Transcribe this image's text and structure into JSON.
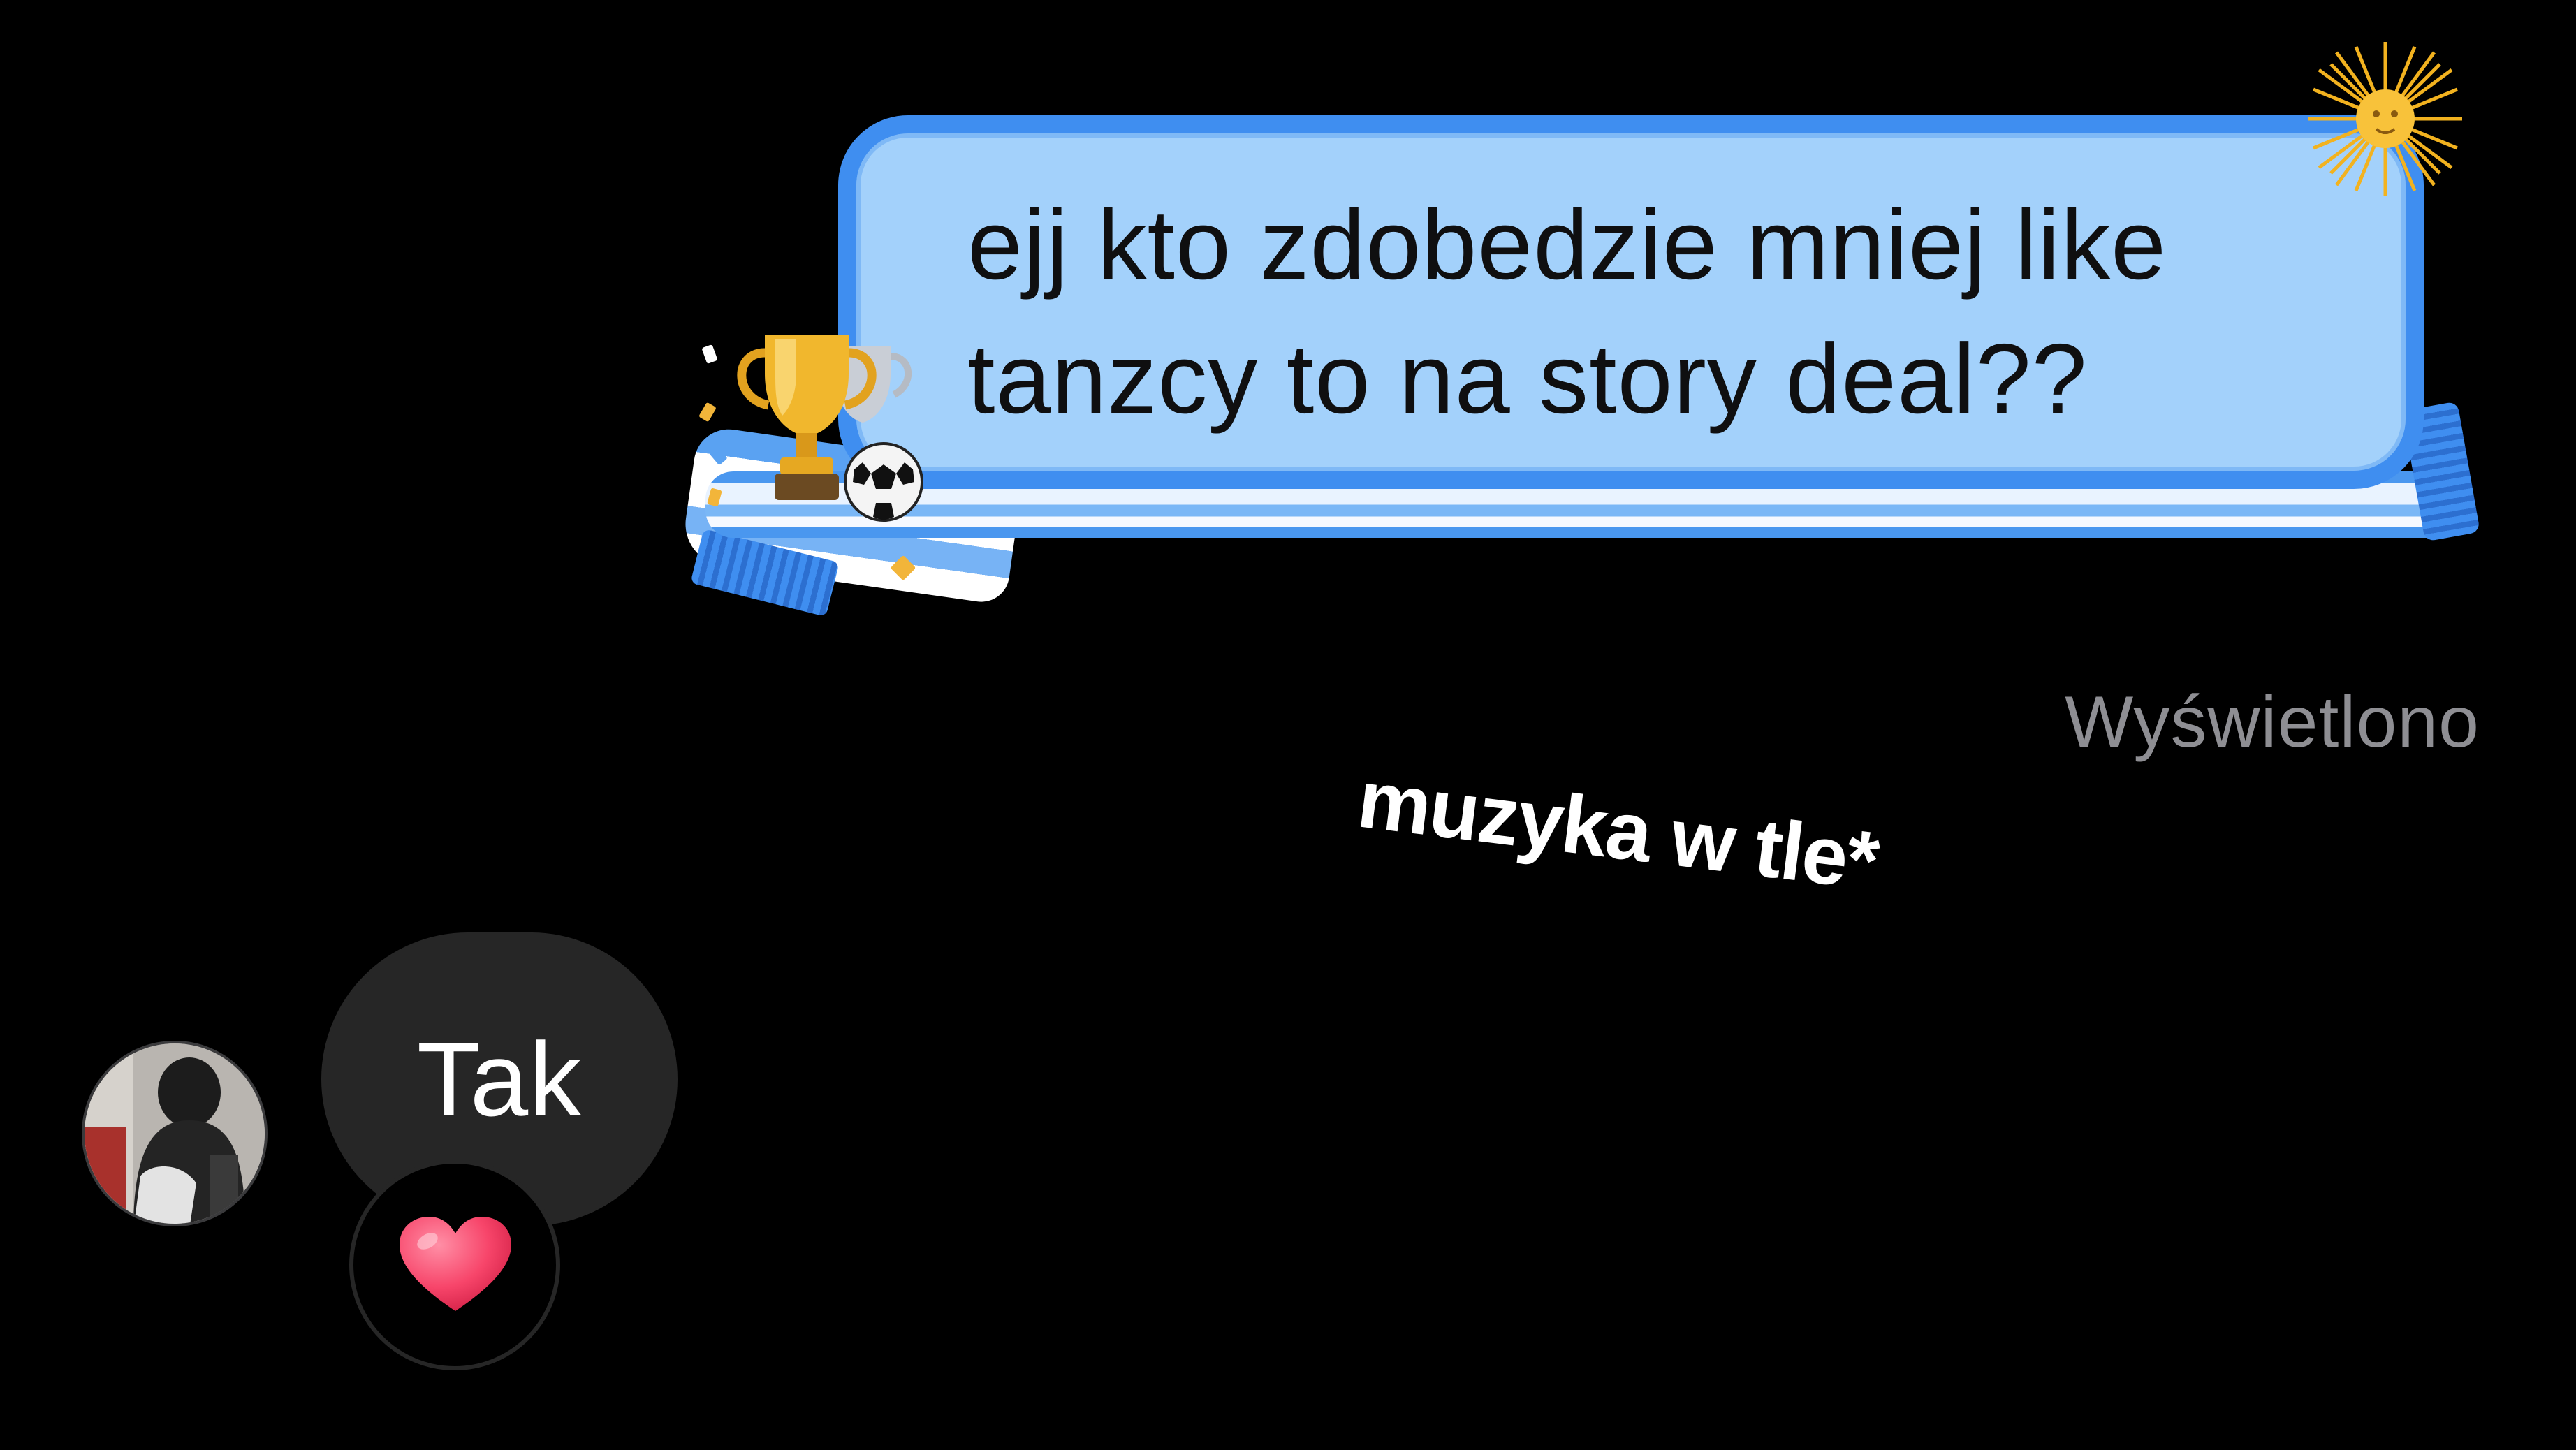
{
  "messages": {
    "outgoing": {
      "line1": "ejj kto zdobedzie mniej like",
      "line2": "tanzcy to na story deal??"
    },
    "status": "Wyświetlono",
    "incoming": {
      "text": "Tak",
      "reaction": "heart-emoji"
    }
  },
  "sticker": {
    "text": "muzyka w tle*"
  },
  "theme": {
    "bubble_fill": "#a3d1fb",
    "bubble_border": "#3f8ef0",
    "incoming_fill": "#262626",
    "status_color": "#8e8e93",
    "heart_color": "#f7456a"
  }
}
